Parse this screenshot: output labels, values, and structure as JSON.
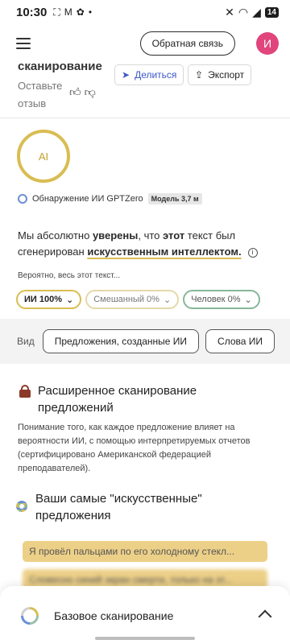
{
  "status": {
    "time": "10:30",
    "battery": "14"
  },
  "header": {
    "feedback_label": "Обратная связь",
    "avatar_letter": "И"
  },
  "scan_summary": {
    "title": "сканирование",
    "feedback_prompt": "Оставьте отзыв",
    "share_label": "Делиться",
    "export_label": "Экспорт"
  },
  "result": {
    "ring_label": "AI",
    "detector_label": "Обнаружение ИИ GPTZero",
    "model_badge": "Модель 3,7 м",
    "verdict_part1": "Мы абсолютно ",
    "verdict_bold1": "уверены",
    "verdict_part2": ", что ",
    "verdict_bold2": "этот",
    "verdict_part3": " текст был сгенерирован ",
    "verdict_highlight": "искусственным интеллектом.",
    "probably_label": "Вероятно, весь этот текст...",
    "pills": {
      "ai": "ИИ 100%",
      "mixed": "Смешанный 0%",
      "human": "Человек 0%"
    },
    "ai_probability": 1.0
  },
  "view": {
    "label": "Вид",
    "option_sentences": "Предложения, созданные ИИ",
    "option_words": "Слова ИИ"
  },
  "advanced": {
    "title": "Расширенное сканирование предложений",
    "description": "Понимание того, как каждое предложение влияет на вероятности ИИ, с помощью интерпретируемых отчетов (сертифицировано Американской федерацией преподавателей).",
    "best_title": "Ваши самые \"искусственные\" предложения",
    "sentences": [
      "Я провёл пальцами по его холодному стекл...",
      "Словесно синий экран смерти, только на эт..."
    ]
  },
  "bottom_sheet": {
    "label": "Базовое сканирование"
  },
  "colors": {
    "ai_accent": "#d9bd52",
    "human_accent": "#86b79a",
    "avatar_bg": "#e0457b",
    "share_text": "#3c57c7"
  }
}
